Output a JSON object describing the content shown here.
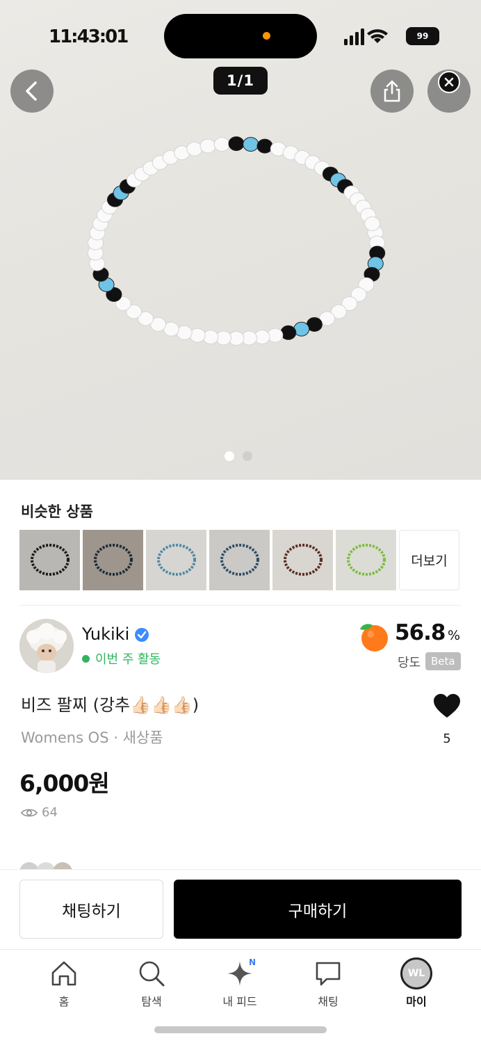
{
  "status_bar": {
    "time": "11:43:01",
    "battery": "99"
  },
  "viewer": {
    "counter": "1/1",
    "dots": [
      true,
      false
    ]
  },
  "similar": {
    "title": "비슷한 상품",
    "more_label": "더보기",
    "thumb_colors": [
      {
        "bg": "#b9b7b3",
        "ring": "#1b1b1b"
      },
      {
        "bg": "#9e958c",
        "ring": "#1b2b3a"
      },
      {
        "bg": "#d7d5d1",
        "ring": "#4c8aa6"
      },
      {
        "bg": "#cbc9c5",
        "ring": "#2d4d66"
      },
      {
        "bg": "#d9d6d1",
        "ring": "#5a2c22"
      },
      {
        "bg": "#dcdcd6",
        "ring": "#7cbb3e"
      }
    ]
  },
  "seller": {
    "name": "Yukiki",
    "activity": "이번 주 활동",
    "temperature": "56.8",
    "temperature_unit": "%",
    "temperature_label": "당도",
    "beta_label": "Beta"
  },
  "product": {
    "title": "비즈 팔찌 (강추👍🏻👍🏻👍🏻)",
    "category": "Womens OS · 새상품",
    "price": "6,000원",
    "views": "64",
    "likes": "5"
  },
  "actions": {
    "chat_label": "채팅하기",
    "buy_label": "구매하기"
  },
  "tabbar": {
    "items": [
      {
        "label": "홈",
        "icon": "home-icon"
      },
      {
        "label": "탐색",
        "icon": "search-icon"
      },
      {
        "label": "내 피드",
        "icon": "sparkle-icon",
        "badge": "N"
      },
      {
        "label": "채팅",
        "icon": "chat-icon"
      },
      {
        "label": "마이",
        "icon": "profile-avatar",
        "avatar_text": "WL"
      }
    ]
  },
  "colors": {
    "accent": "#000000",
    "activity_green": "#2fb55f",
    "verified_blue": "#3d8bff",
    "orange": "#ff7a1a"
  }
}
